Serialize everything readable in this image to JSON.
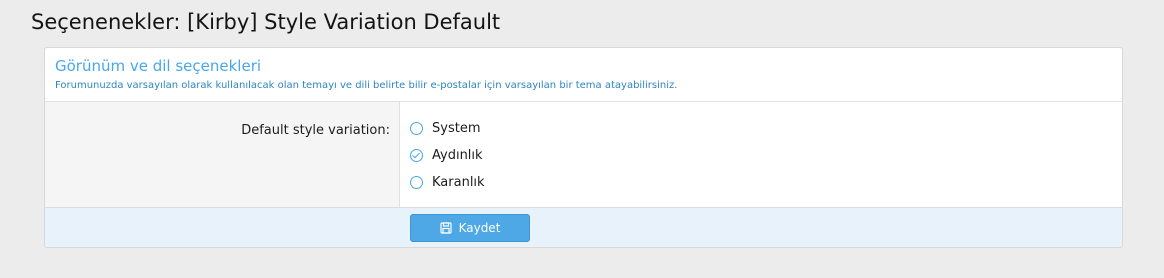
{
  "page": {
    "title": "Seçenenekler: [Kirby] Style Variation Default"
  },
  "section": {
    "title": "Görünüm ve dil seçenekleri",
    "description": "Forumunuzda varsayılan olarak kullanılacak olan temayı ve dili belirte bilir e-postalar için varsayılan bir tema atayabilirsiniz."
  },
  "option": {
    "label": "Default style variation:",
    "choices": [
      {
        "label": "System",
        "selected": false
      },
      {
        "label": "Aydınlık",
        "selected": true
      },
      {
        "label": "Karanlık",
        "selected": false
      }
    ]
  },
  "actions": {
    "save_label": "Kaydet",
    "save_icon": "save-icon"
  },
  "colors": {
    "accent": "#47a7eb",
    "button": "#4ea8e6",
    "submit_bg": "#e7f2fb"
  }
}
